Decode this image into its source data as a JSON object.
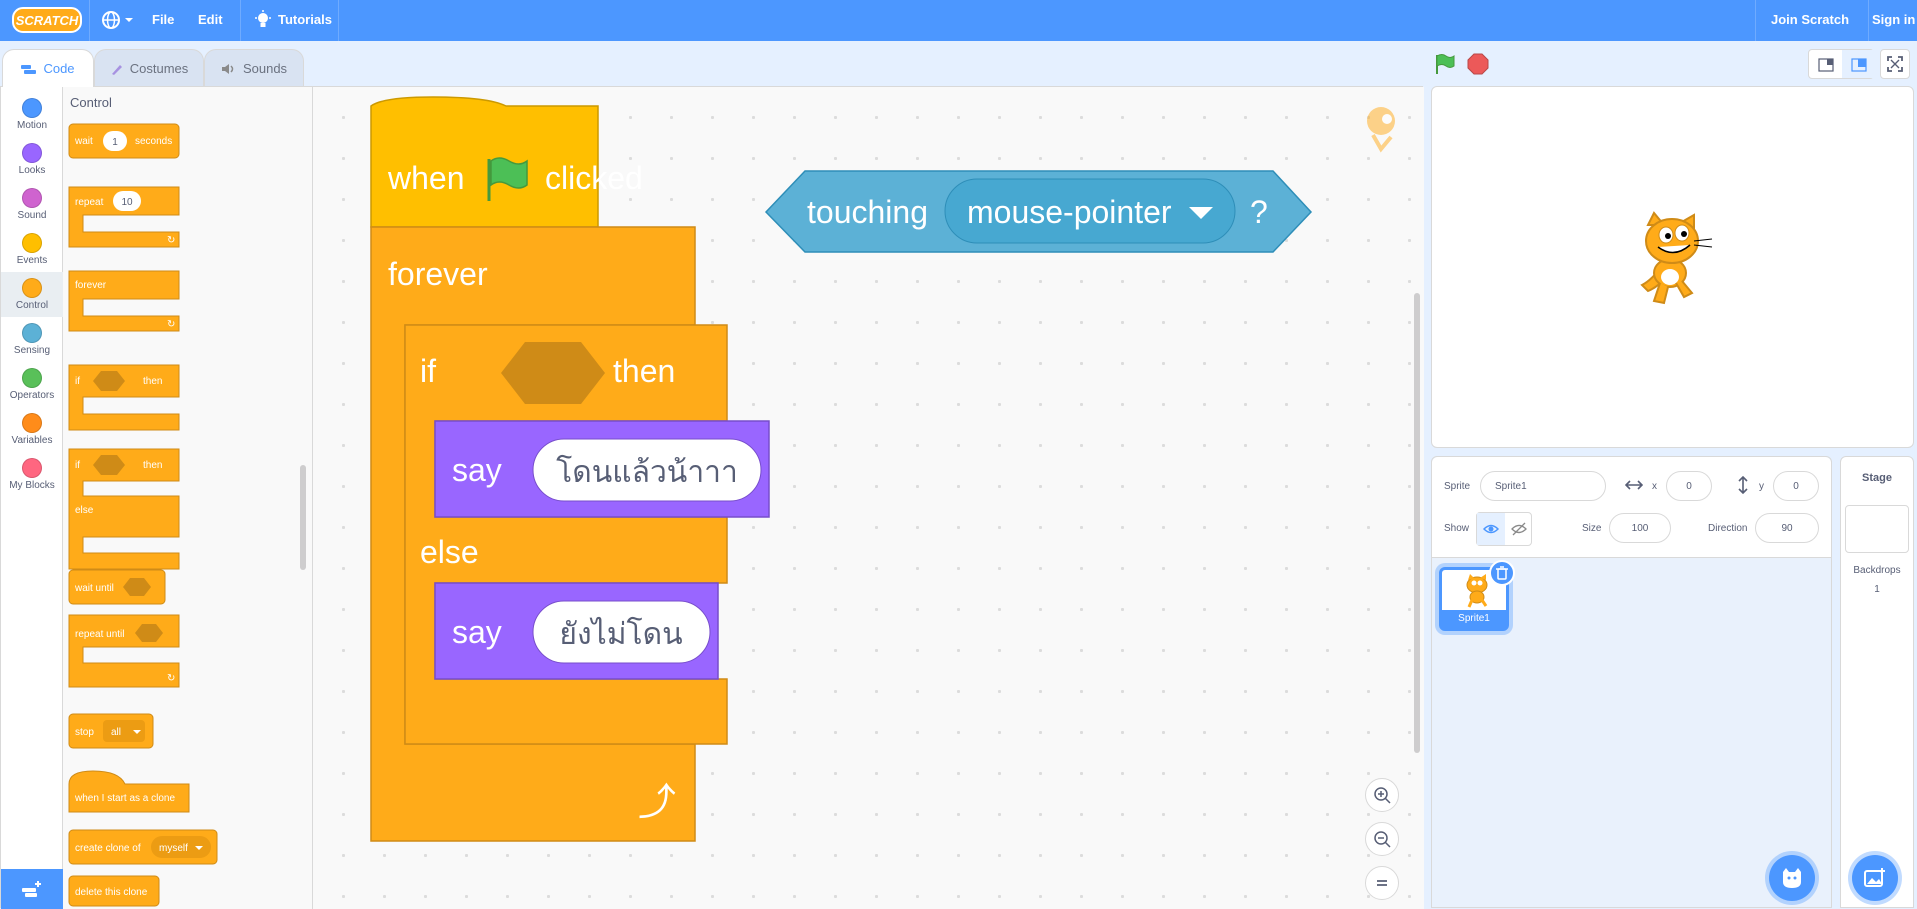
{
  "menu": {
    "file": "File",
    "edit": "Edit",
    "tutorials": "Tutorials",
    "join": "Join Scratch",
    "signin": "Sign in",
    "logo": "SCRATCH"
  },
  "tabs": {
    "code": "Code",
    "costumes": "Costumes",
    "sounds": "Sounds"
  },
  "categories": [
    {
      "label": "Motion",
      "color": "#4c97ff"
    },
    {
      "label": "Looks",
      "color": "#9966ff"
    },
    {
      "label": "Sound",
      "color": "#cf63cf"
    },
    {
      "label": "Events",
      "color": "#ffbf00"
    },
    {
      "label": "Control",
      "color": "#ffab19"
    },
    {
      "label": "Sensing",
      "color": "#5cb1d6"
    },
    {
      "label": "Operators",
      "color": "#59c059"
    },
    {
      "label": "Variables",
      "color": "#ff8c1a"
    },
    {
      "label": "My Blocks",
      "color": "#ff6680"
    }
  ],
  "palette": {
    "title": "Control",
    "wait": "wait",
    "wait_val": "1",
    "seconds": "seconds",
    "repeat": "repeat",
    "repeat_val": "10",
    "forever": "forever",
    "if": "if",
    "then": "then",
    "else": "else",
    "wait_until": "wait until",
    "repeat_until": "repeat until",
    "stop": "stop",
    "stop_val": "all",
    "clone_start": "when I start as a clone",
    "create_clone": "create clone of",
    "create_clone_val": "myself",
    "delete_clone": "delete this clone"
  },
  "script": {
    "when": "when",
    "clicked": "clicked",
    "forever": "forever",
    "if": "if",
    "then": "then",
    "else": "else",
    "say1": "say",
    "say1_text": "โดนแล้วน้าาา",
    "say2": "say",
    "say2_text": "ยังไม่โดน"
  },
  "sensing_block": {
    "label": "touching",
    "menu": "mouse-pointer",
    "q": "?"
  },
  "sprite_info": {
    "sprite_label": "Sprite",
    "sprite_name": "Sprite1",
    "x_label": "x",
    "x_val": "0",
    "y_label": "y",
    "y_val": "0",
    "show_label": "Show",
    "size_label": "Size",
    "size_val": "100",
    "dir_label": "Direction",
    "dir_val": "90"
  },
  "sprites": [
    {
      "name": "Sprite1"
    }
  ],
  "stage_col": {
    "title": "Stage",
    "backdrops_label": "Backdrops",
    "backdrops_count": "1"
  },
  "colors": {
    "accent": "#4c97ff",
    "control": "#ffab19",
    "events": "#ffbf00",
    "looks": "#9966ff",
    "sensing": "#5cb1d6"
  }
}
